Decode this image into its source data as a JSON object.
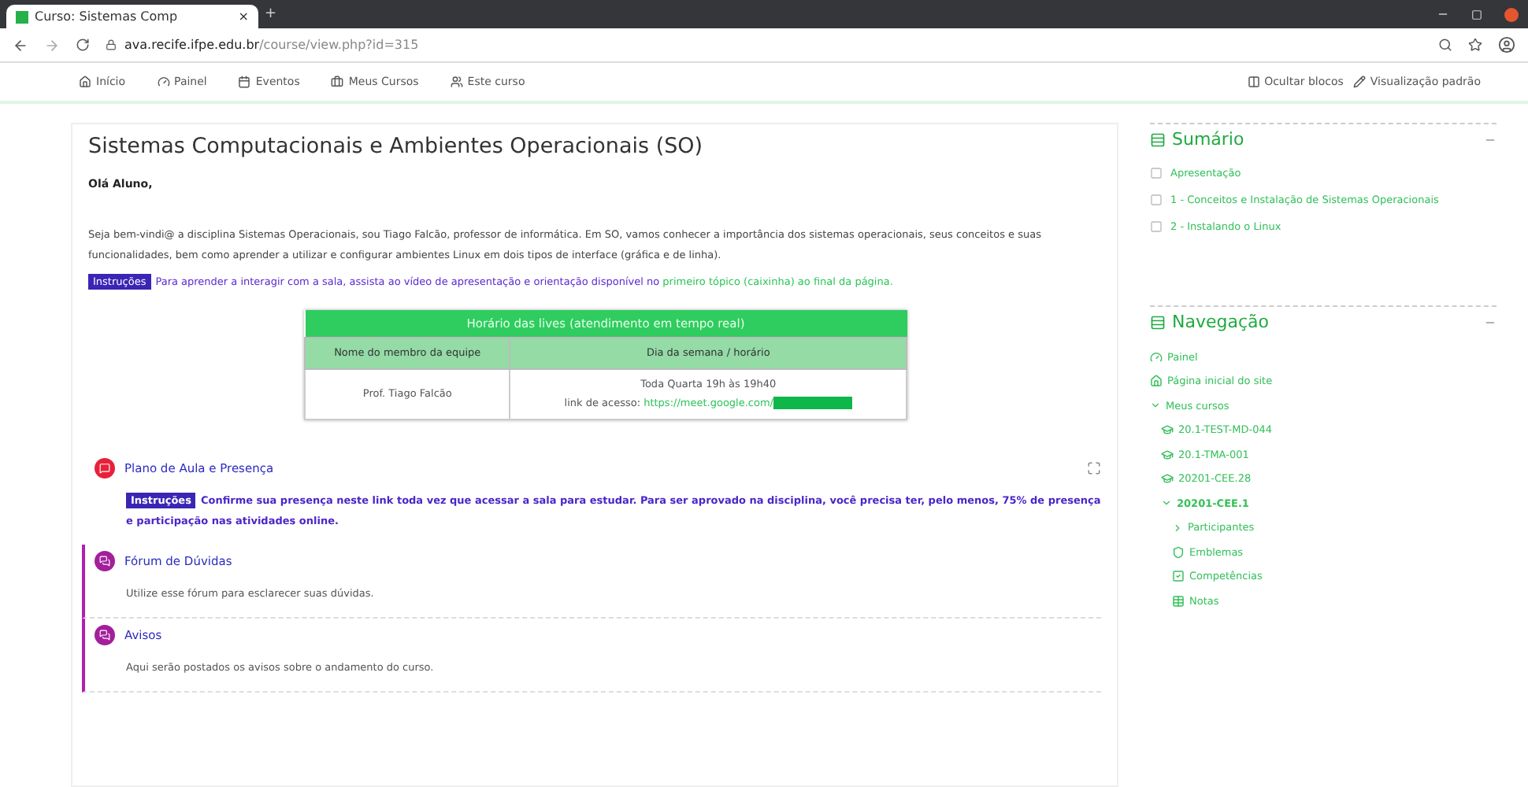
{
  "browser": {
    "tab_title": "Curso: Sistemas Comp",
    "tab_close": "×",
    "new_tab": "+",
    "url_host": "ava.recife.ifpe.edu.br",
    "url_path": "/course/view.php?id=315"
  },
  "navbar": {
    "items": [
      {
        "label": "Início",
        "kind": "home"
      },
      {
        "label": "Painel",
        "kind": "dashboard"
      },
      {
        "label": "Eventos",
        "kind": "calendar"
      },
      {
        "label": "Meus Cursos",
        "kind": "briefcase"
      },
      {
        "label": "Este curso",
        "kind": "users"
      }
    ],
    "right": [
      {
        "label": "Ocultar blocos",
        "kind": "blocks"
      },
      {
        "label": "Visualização padrão",
        "kind": "pen"
      }
    ]
  },
  "course": {
    "title": "Sistemas Computacionais e Ambientes Operacionais (SO)",
    "greeting": "Olá Aluno,",
    "intro": "Seja bem-vindi@ a disciplina Sistemas Operacionais, sou Tiago Falcão, professor de informática. Em SO, vamos conhecer a importância dos sistemas operacionais, seus conceitos e suas funcionalidades, bem como aprender a utilizar e configurar ambientes Linux em dois tipos de interface (gráfica e de linha).",
    "badge": "Instruções",
    "instruction": "Para aprender a interagir com a sala, assista ao vídeo de apresentação e orientação disponível no ",
    "instruction_link": "primeiro tópico (caixinha) ao final da página."
  },
  "schedule": {
    "title": "Horário das lives (atendimento em tempo real)",
    "columns": [
      "Nome do membro da equipe",
      "Dia da semana / horário"
    ],
    "member": "Prof. Tiago Falcão",
    "time": "Toda Quarta 19h às 19h40",
    "link_label": "link de acesso: ",
    "link": "https://meet.google.com/"
  },
  "activities": [
    {
      "kind": "attendance",
      "title": "Plano de Aula e Presença",
      "badge": "Instruções",
      "text": "Confirme sua presença neste link toda vez que acessar a sala para estudar. Para ser aprovado na disciplina, você precisa ter, pelo menos, 75% de presença e participação nas atividades online.",
      "color": "#e8213a"
    },
    {
      "kind": "forum",
      "title": "Fórum de Dúvidas",
      "text": "Utilize esse fórum para esclarecer suas dúvidas.",
      "color": "#a31f9c"
    },
    {
      "kind": "forum",
      "title": "Avisos",
      "text": "Aqui serão postados os avisos sobre o andamento do curso.",
      "color": "#a31f9c"
    }
  ],
  "summary": {
    "title": "Sumário",
    "items": [
      {
        "label": "Apresentação"
      },
      {
        "label": "1 - Conceitos e Instalação de Sistemas Operacionais"
      },
      {
        "label": "2 - Instalando o Linux"
      }
    ]
  },
  "navigation": {
    "title": "Navegação",
    "items": [
      {
        "label": "Painel",
        "kind": "dashboard"
      },
      {
        "label": "Página inicial do site",
        "kind": "home"
      },
      {
        "label": "Meus cursos",
        "kind": "folder",
        "expanded": true,
        "children": [
          {
            "label": "20.1-TEST-MD-044",
            "kind": "cap"
          },
          {
            "label": "20.1-TMA-001",
            "kind": "cap"
          },
          {
            "label": "20201-CEE.28",
            "kind": "cap"
          },
          {
            "label": "20201-CEE.1",
            "kind": "folder",
            "expanded": true,
            "current": true,
            "children": [
              {
                "label": "Participantes",
                "kind": "folder",
                "expanded": false
              },
              {
                "label": "Emblemas",
                "kind": "shield"
              },
              {
                "label": "Competências",
                "kind": "check"
              },
              {
                "label": "Notas",
                "kind": "table"
              }
            ]
          }
        ]
      }
    ]
  }
}
